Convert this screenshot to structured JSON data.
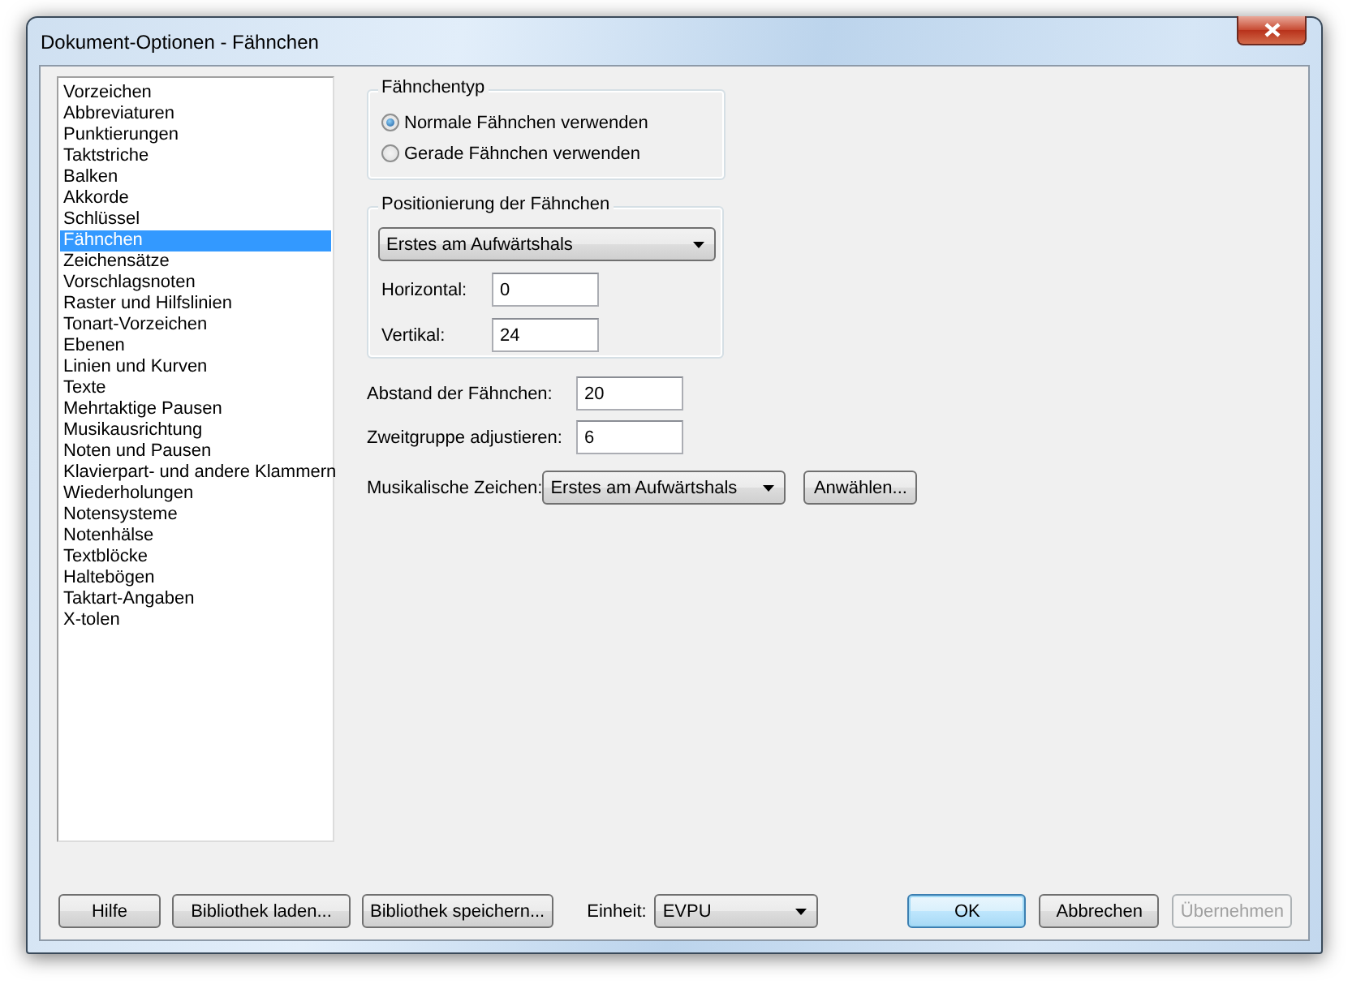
{
  "window": {
    "title": "Dokument-Optionen - Fähnchen"
  },
  "categories": [
    {
      "label": "Vorzeichen",
      "selected": false
    },
    {
      "label": "Abbreviaturen",
      "selected": false
    },
    {
      "label": "Punktierungen",
      "selected": false
    },
    {
      "label": "Taktstriche",
      "selected": false
    },
    {
      "label": "Balken",
      "selected": false
    },
    {
      "label": "Akkorde",
      "selected": false
    },
    {
      "label": "Schlüssel",
      "selected": false
    },
    {
      "label": "Fähnchen",
      "selected": true
    },
    {
      "label": "Zeichensätze",
      "selected": false
    },
    {
      "label": "Vorschlagsnoten",
      "selected": false
    },
    {
      "label": "Raster und Hilfslinien",
      "selected": false
    },
    {
      "label": "Tonart-Vorzeichen",
      "selected": false
    },
    {
      "label": "Ebenen",
      "selected": false
    },
    {
      "label": "Linien und Kurven",
      "selected": false
    },
    {
      "label": "Texte",
      "selected": false
    },
    {
      "label": "Mehrtaktige Pausen",
      "selected": false
    },
    {
      "label": "Musikausrichtung",
      "selected": false
    },
    {
      "label": "Noten und Pausen",
      "selected": false
    },
    {
      "label": "Klavierpart- und andere Klammern",
      "selected": false
    },
    {
      "label": "Wiederholungen",
      "selected": false
    },
    {
      "label": "Notensysteme",
      "selected": false
    },
    {
      "label": "Notenhälse",
      "selected": false
    },
    {
      "label": "Textblöcke",
      "selected": false
    },
    {
      "label": "Haltebögen",
      "selected": false
    },
    {
      "label": "Taktart-Angaben",
      "selected": false
    },
    {
      "label": "X-tolen",
      "selected": false
    }
  ],
  "flag_type": {
    "title": "Fähnchentyp",
    "options": [
      {
        "label": "Normale Fähnchen verwenden",
        "selected": true
      },
      {
        "label": "Gerade Fähnchen verwenden",
        "selected": false
      }
    ]
  },
  "positioning": {
    "title": "Positionierung der Fähnchen",
    "dropdown": "Erstes am Aufwärtshals",
    "fields": [
      {
        "label": "Horizontal:",
        "value": "0"
      },
      {
        "label": "Vertikal:",
        "value": "24"
      }
    ]
  },
  "settings": [
    {
      "label": "Abstand der Fähnchen:",
      "value": "20"
    },
    {
      "label": "Zweitgruppe adjustieren:",
      "value": "6"
    }
  ],
  "music_symbols": {
    "label": "Musikalische Zeichen:",
    "dropdown": "Erstes am Aufwärtshals",
    "button": "Anwählen..."
  },
  "footer": {
    "buttons_left": [
      {
        "label": "Hilfe",
        "default": false,
        "disabled": false
      },
      {
        "label": "Bibliothek laden...",
        "default": false,
        "disabled": false
      },
      {
        "label": "Bibliothek speichern...",
        "default": false,
        "disabled": false
      }
    ],
    "unit_label": "Einheit:",
    "unit": "EVPU",
    "buttons_right": [
      {
        "label": "OK",
        "default": true,
        "disabled": false
      },
      {
        "label": "Abbrechen",
        "default": false,
        "disabled": false
      },
      {
        "label": "Übernehmen",
        "default": false,
        "disabled": true
      }
    ]
  }
}
